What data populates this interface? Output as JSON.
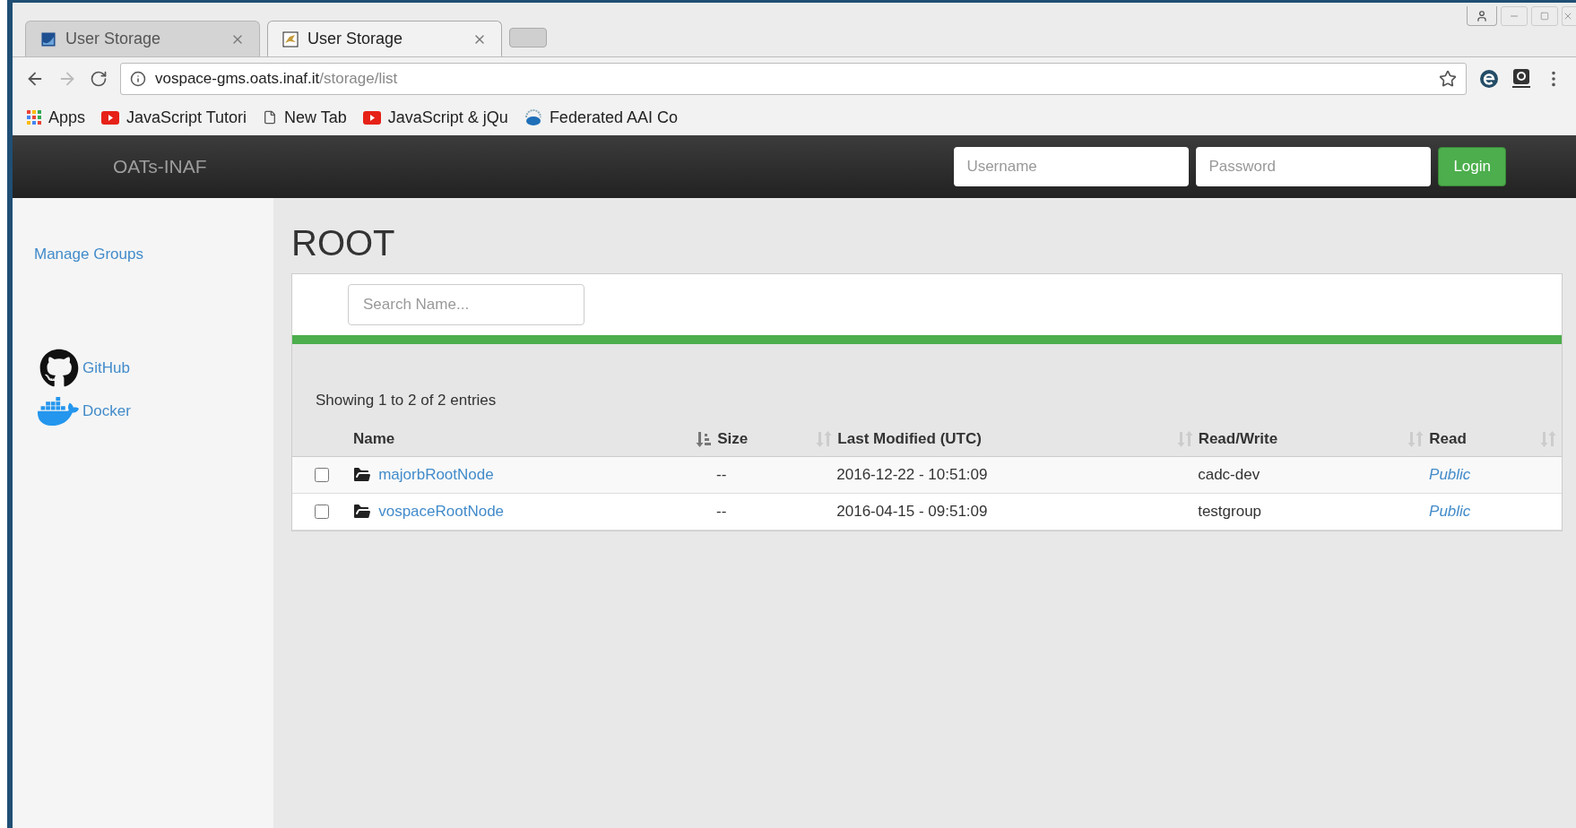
{
  "browser": {
    "tabs": [
      {
        "title": "User Storage",
        "kind": "blue",
        "selected": false
      },
      {
        "title": "User Storage",
        "kind": "bird",
        "selected": true
      }
    ],
    "url": {
      "host": "vospace-gms.oats.inaf.it",
      "path": "/storage/list"
    },
    "bookmarks": [
      {
        "kind": "apps",
        "label": "Apps"
      },
      {
        "kind": "video",
        "label": "JavaScript Tutori"
      },
      {
        "kind": "page",
        "label": "New Tab"
      },
      {
        "kind": "video",
        "label": "JavaScript & jQu"
      },
      {
        "kind": "egi",
        "label": "Federated AAI Co"
      }
    ]
  },
  "navbar": {
    "brand": "OATs-INAF",
    "username": {
      "placeholder": "Username"
    },
    "password": {
      "placeholder": "Password"
    },
    "login": "Login"
  },
  "sidebar": {
    "links": [
      {
        "kind": "text",
        "label": "Manage Groups"
      },
      {
        "kind": "github",
        "label": "GitHub"
      },
      {
        "kind": "docker",
        "label": "Docker"
      }
    ]
  },
  "page": {
    "title": "ROOT",
    "search": {
      "placeholder": "Search Name..."
    },
    "info": "Showing 1 to 2 of 2 entries"
  },
  "table": {
    "columns": [
      {
        "label": "Name",
        "sorted": true
      },
      {
        "label": "Size",
        "sorted": false
      },
      {
        "label": "Last Modified (UTC)",
        "sorted": false
      },
      {
        "label": "Read/Write",
        "sorted": false
      },
      {
        "label": "Read",
        "sorted": false
      }
    ],
    "rows": [
      {
        "checked": false,
        "name": "majorbRootNode",
        "size": "--",
        "modified": "2016-12-22 - 10:51:09",
        "read_write": "cadc-dev",
        "read": "Public"
      },
      {
        "checked": false,
        "name": "vospaceRootNode",
        "size": "--",
        "modified": "2016-04-15 - 09:51:09",
        "read_write": "testgroup",
        "read": "Public"
      }
    ]
  }
}
